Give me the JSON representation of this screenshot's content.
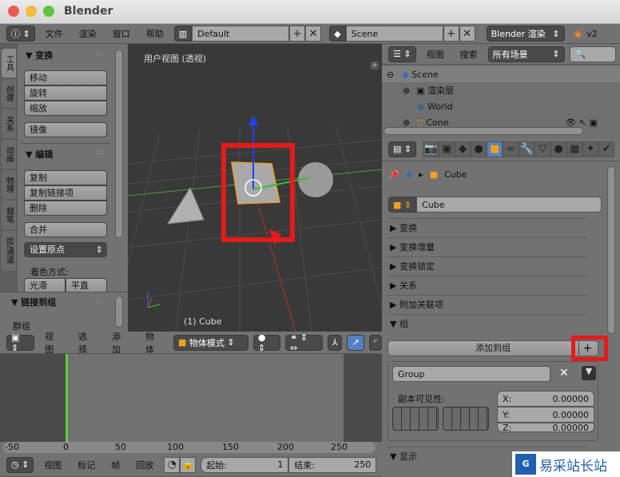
{
  "window": {
    "title": "Blender"
  },
  "topbar": {
    "menus": [
      "文件",
      "渲染",
      "窗口",
      "帮助"
    ],
    "layout": "Default",
    "scene": "Scene",
    "engine": "Blender 渲染",
    "version": "v2"
  },
  "toolshelf": {
    "tabs": [
      "工具",
      "创建",
      "关系",
      "动画",
      "物理",
      "蜡笔",
      "层/通道"
    ],
    "transform_title": "▼ 变换",
    "transform_buttons": [
      "移动",
      "旋转",
      "缩放"
    ],
    "mirror": "镜像",
    "edit_title": "▼ 编辑",
    "edit_buttons": [
      "复制",
      "复制链接项",
      "删除"
    ],
    "join": "合并",
    "set_origin": "设置原点",
    "shading_label": "着色方式:",
    "shading_buttons": [
      "光滑",
      "平直"
    ],
    "link_group_title": "▼ 链接到组",
    "group_label": "群组"
  },
  "viewport": {
    "view_label": "用户视图 (透视)",
    "object_label": "(1) Cube"
  },
  "view3d_header": {
    "menus": [
      "视图",
      "选择",
      "添加",
      "物体"
    ],
    "mode": "物体模式"
  },
  "outliner": {
    "menus": [
      "视图",
      "搜索"
    ],
    "filter": "所有场景",
    "items": [
      "Scene",
      "渲染层",
      "World",
      "Cone"
    ]
  },
  "properties": {
    "breadcrumb": "Cube",
    "object_name": "Cube",
    "panels": [
      "▶ 变换",
      "▶ 变换增量",
      "▶ 变换锁定",
      "▶ 关系",
      "▶ 附加关联项",
      "▼ 组"
    ],
    "add_to_group": "添加到组",
    "group_name": "Group",
    "dupli_visibility": "副本可见性:",
    "offset": [
      {
        "label": "X:",
        "value": "0.00000"
      },
      {
        "label": "Y:",
        "value": "0.00000"
      },
      {
        "label": "Z:",
        "value": "0.00000"
      }
    ],
    "display_panel": "▼ 显示"
  },
  "timeline": {
    "ticks": [
      "-50",
      "0",
      "50",
      "100",
      "150",
      "200",
      "250"
    ],
    "current_frame": 0,
    "menus": [
      "视图",
      "标记",
      "帧",
      "回放"
    ],
    "start_label": "起始:",
    "start": "1",
    "end_label": "结束:",
    "end": "250"
  },
  "watermark": {
    "text": "易采站长站"
  },
  "colors": {
    "highlight": "#e41b1b",
    "active_tab": "#5680c2",
    "frame_line": "#5fd13a"
  }
}
